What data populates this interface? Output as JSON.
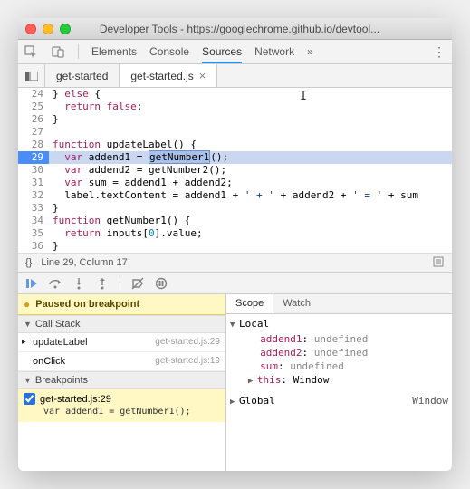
{
  "window": {
    "title": "Developer Tools - https://googlechrome.github.io/devtool..."
  },
  "nav": {
    "tabs": [
      "Elements",
      "Console",
      "Sources",
      "Network"
    ],
    "active": "Sources",
    "overflow": "»"
  },
  "file_tabs": {
    "items": [
      {
        "label": "get-started",
        "closable": false,
        "active": false
      },
      {
        "label": "get-started.js",
        "closable": true,
        "active": true
      }
    ]
  },
  "code": {
    "lines": [
      {
        "n": 24,
        "html": "} <span class='kw'>else</span> {"
      },
      {
        "n": 25,
        "html": "  <span class='kw'>return</span> <span class='kw'>false</span>;"
      },
      {
        "n": 26,
        "html": "}"
      },
      {
        "n": 27,
        "html": ""
      },
      {
        "n": 28,
        "html": "<span class='kw'>function</span> <span class='fn'>updateLabel</span>() {"
      },
      {
        "n": 29,
        "hl": true,
        "html": "  <span class='kw'>var</span> addend1 = <span class='sel-hl'>getNumber1</span>();"
      },
      {
        "n": 30,
        "html": "  <span class='kw'>var</span> addend2 = getNumber2();"
      },
      {
        "n": 31,
        "html": "  <span class='kw'>var</span> sum = addend1 + addend2;"
      },
      {
        "n": 32,
        "html": "  label.textContent = addend1 + <span class='str'>' + '</span> + addend2 + <span class='str'>' = '</span> + sum"
      },
      {
        "n": 33,
        "html": "}"
      },
      {
        "n": 34,
        "html": "<span class='kw'>function</span> <span class='fn'>getNumber1</span>() {"
      },
      {
        "n": 35,
        "html": "  <span class='kw'>return</span> inputs[<span class='num'>0</span>].value;"
      },
      {
        "n": 36,
        "html": "}"
      }
    ]
  },
  "status": {
    "braces": "{}",
    "position": "Line 29, Column 17"
  },
  "paused": {
    "text": "Paused on breakpoint"
  },
  "call_stack": {
    "header": "Call Stack",
    "items": [
      {
        "name": "updateLabel",
        "loc": "get-started.js:29",
        "active": true
      },
      {
        "name": "onClick",
        "loc": "get-started.js:19",
        "active": false
      }
    ]
  },
  "breakpoints": {
    "header": "Breakpoints",
    "items": [
      {
        "checked": true,
        "label": "get-started.js:29",
        "code": "var addend1 = getNumber1();"
      }
    ]
  },
  "scope": {
    "tabs": [
      "Scope",
      "Watch"
    ],
    "active": "Scope",
    "local_label": "Local",
    "vars": [
      {
        "name": "addend1",
        "value": "undefined"
      },
      {
        "name": "addend2",
        "value": "undefined"
      },
      {
        "name": "sum",
        "value": "undefined"
      }
    ],
    "this": {
      "name": "this",
      "value": "Window"
    },
    "global": {
      "name": "Global",
      "value": "Window"
    }
  }
}
